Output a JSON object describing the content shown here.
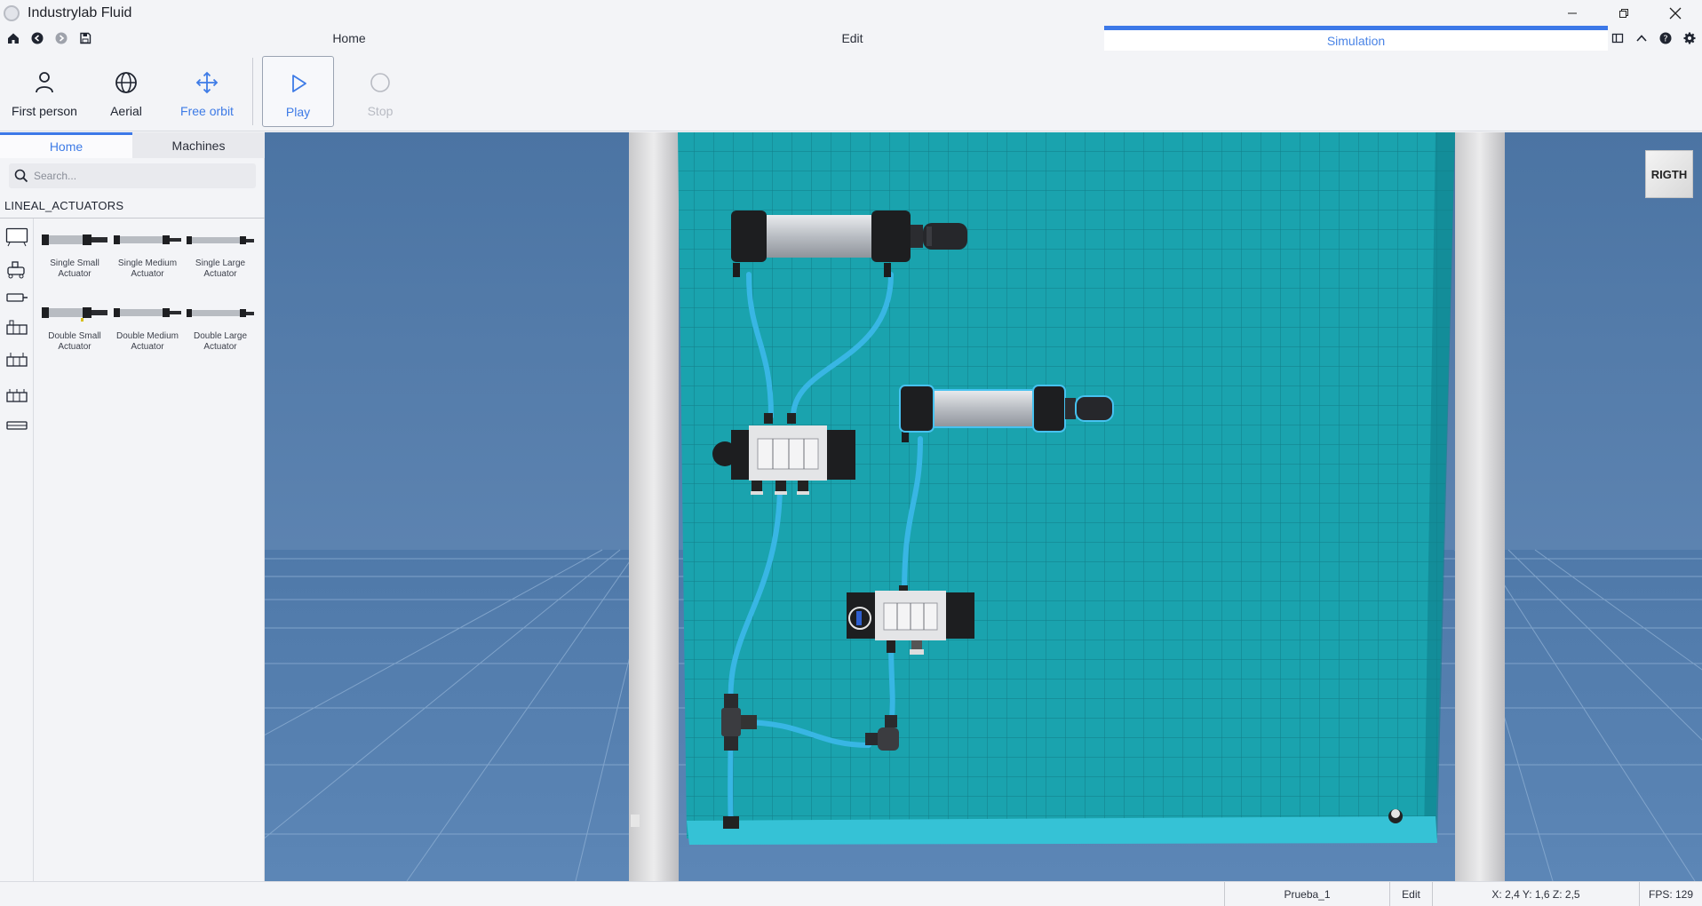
{
  "app": {
    "title": "Industrylab Fluid"
  },
  "tabs": {
    "home": "Home",
    "edit": "Edit",
    "simulation": "Simulation"
  },
  "toolbar": {
    "first_person": "First person",
    "aerial": "Aerial",
    "free_orbit": "Free orbit",
    "play": "Play",
    "stop": "Stop"
  },
  "sidebar": {
    "tabs": {
      "home": "Home",
      "machines": "Machines"
    },
    "search_placeholder": "Search...",
    "category": "LINEAL_ACTUATORS",
    "items": [
      {
        "line1": "Single Small",
        "line2": "Actuator"
      },
      {
        "line1": "Single Medium",
        "line2": "Actuator"
      },
      {
        "line1": "Single Large",
        "line2": "Actuator"
      },
      {
        "line1": "Double Small",
        "line2": "Actuator"
      },
      {
        "line1": "Double Medium",
        "line2": "Actuator"
      },
      {
        "line1": "Double Large",
        "line2": "Actuator"
      }
    ]
  },
  "viewport": {
    "view_cube_label": "RIGTH"
  },
  "status": {
    "project": "Prueba_1",
    "mode": "Edit",
    "coords": "X: 2,4  Y: 1,6  Z: 2,5",
    "fps": "FPS: 129"
  },
  "colors": {
    "accent": "#3c78e8",
    "panel": "#1aa0ab",
    "tube": "#3ab8e6",
    "floor": "#5580b0"
  },
  "icons": {
    "home": "home-icon",
    "back": "back-icon",
    "forward": "forward-icon",
    "save": "save-icon",
    "panel_toggle": "panel-icon",
    "collapse": "chevron-up-icon",
    "help": "help-icon",
    "settings": "gear-icon"
  }
}
